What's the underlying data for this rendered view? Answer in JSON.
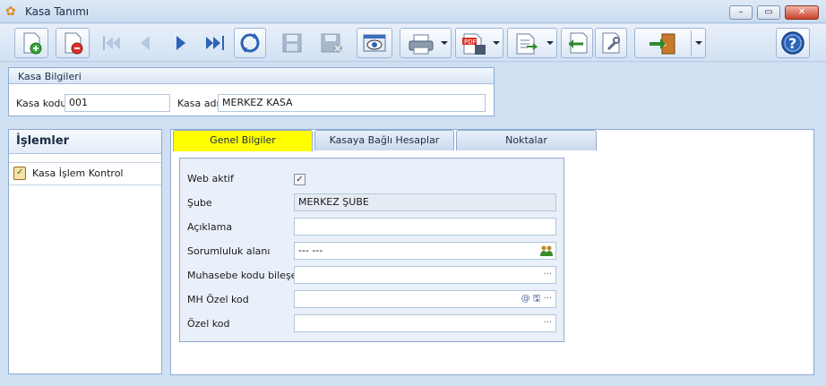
{
  "window": {
    "title": "Kasa Tanımı",
    "controls": {
      "minimize": "–",
      "maximize": "▭",
      "close": "✕"
    }
  },
  "toolbar": {
    "buttons": [
      {
        "name": "new-record-button",
        "icon": "new-doc-icon",
        "enabled": true
      },
      {
        "name": "delete-record-button",
        "icon": "delete-doc-icon",
        "enabled": true
      },
      {
        "name": "first-record-button",
        "icon": "first-icon",
        "enabled": false
      },
      {
        "name": "prev-record-button",
        "icon": "prev-icon",
        "enabled": false
      },
      {
        "name": "next-record-button",
        "icon": "next-icon",
        "enabled": true
      },
      {
        "name": "last-record-button",
        "icon": "last-icon",
        "enabled": true
      },
      {
        "name": "refresh-button",
        "icon": "refresh-icon",
        "enabled": true
      },
      {
        "name": "save-button",
        "icon": "save-icon",
        "enabled": false
      },
      {
        "name": "save-close-button",
        "icon": "save-cancel-icon",
        "enabled": false
      },
      {
        "name": "preview-button",
        "icon": "preview-icon",
        "enabled": true
      },
      {
        "name": "print-button",
        "icon": "printer-icon",
        "enabled": true
      },
      {
        "name": "pdf-export-button",
        "icon": "pdf-icon",
        "enabled": true
      },
      {
        "name": "export-button",
        "icon": "export-icon",
        "enabled": true
      },
      {
        "name": "import-button",
        "icon": "import-icon",
        "enabled": true
      },
      {
        "name": "tools-button",
        "icon": "wrench-icon",
        "enabled": true
      },
      {
        "name": "exit-button",
        "icon": "exit-door-icon",
        "enabled": true
      },
      {
        "name": "help-button",
        "icon": "help-icon",
        "enabled": true
      }
    ]
  },
  "kasa_bilgileri": {
    "title": "Kasa Bilgileri",
    "kasa_kodu_label": "Kasa kodu",
    "kasa_kodu_value": "001",
    "kasa_adi_label": "Kasa adı",
    "kasa_adi_value": "MERKEZ KASA"
  },
  "left_panel": {
    "title": "İşlemler",
    "items": [
      {
        "label": "Kasa İşlem Kontrol",
        "icon": "clipboard-check-icon"
      }
    ]
  },
  "tabs": [
    {
      "label": "Genel Bilgiler",
      "active": true
    },
    {
      "label": "Kasaya Bağlı Hesaplar",
      "active": false
    },
    {
      "label": "Noktalar",
      "active": false
    }
  ],
  "form": {
    "web_aktif": {
      "label": "Web aktif",
      "checked": true,
      "mark": "✓"
    },
    "sube": {
      "label": "Şube",
      "value": "MERKEZ ŞUBE"
    },
    "aciklama": {
      "label": "Açıklama",
      "value": ""
    },
    "sorumluluk": {
      "label": "Sorumluluk alanı",
      "value": "--- ---",
      "icon": "people-icon"
    },
    "muhasebe": {
      "label": "Muhasebe kodu bileşeni",
      "value": "",
      "trail": "···"
    },
    "mh_ozel_kod": {
      "label": "MH Özel kod",
      "value": "",
      "trail": "@ 🖫 ···"
    },
    "ozel_kod": {
      "label": "Özel kod",
      "value": "",
      "trail": "···"
    }
  },
  "colors": {
    "active_tab": "#ffff00",
    "panel_bg": "#cfe0f3",
    "border": "#8eaad0"
  }
}
